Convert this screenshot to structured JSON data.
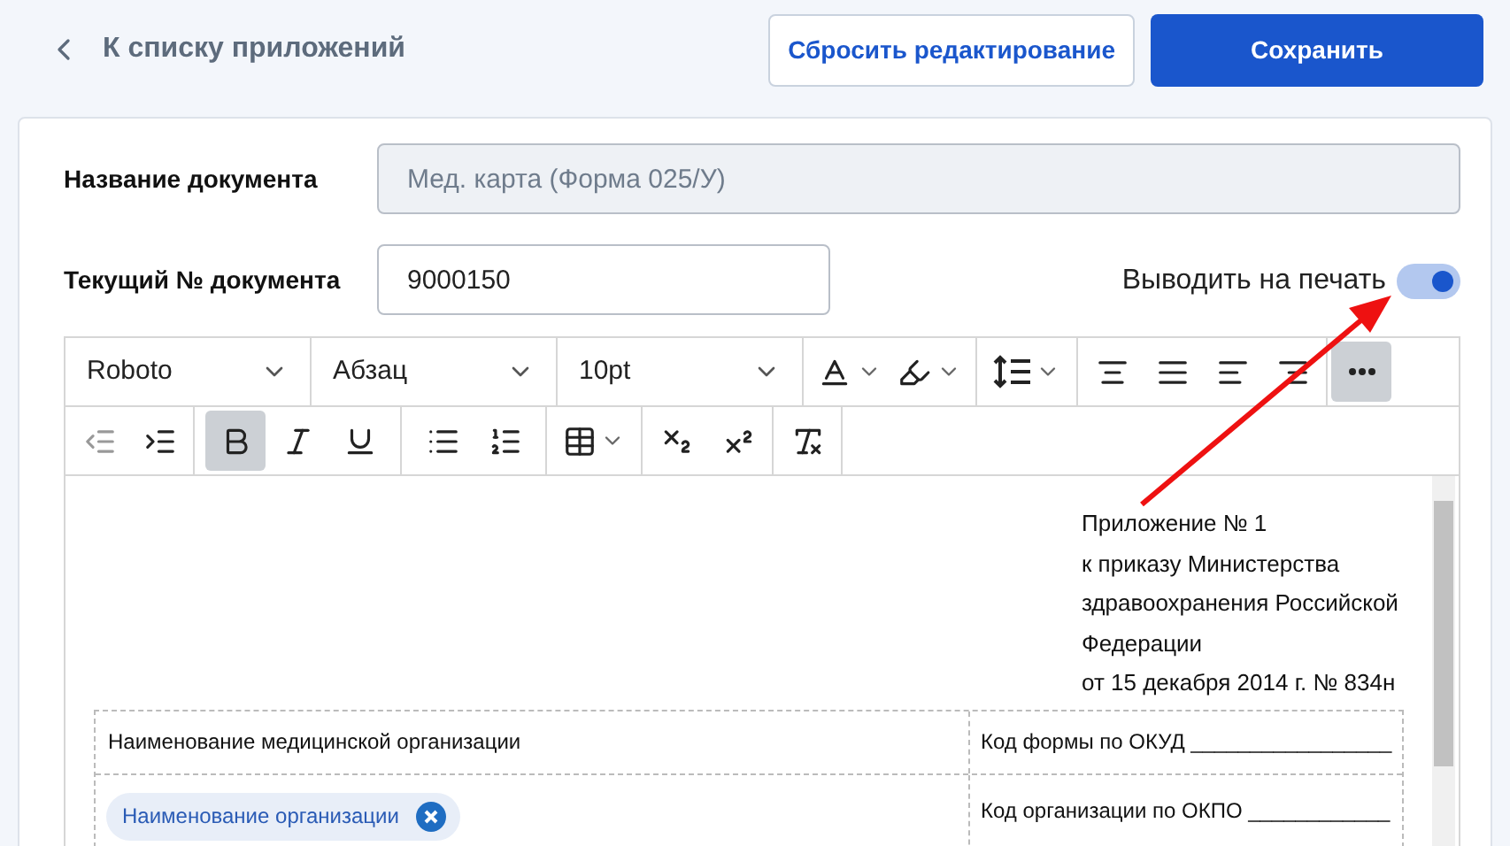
{
  "back_link": {
    "label": "К списку приложений"
  },
  "buttons": [
    {
      "kind": "secondary",
      "label": "Сбросить редактирование"
    },
    {
      "kind": "primary",
      "label": "Сохранить"
    }
  ],
  "form": {
    "document_name": {
      "label": "Название документа",
      "value": "Мед. карта (Форма 025/У)",
      "disabled": true
    },
    "document_number": {
      "label": "Текущий № документа",
      "value": "9000150",
      "disabled": false
    },
    "print_toggle": {
      "label": "Выводить на печать",
      "on": true
    }
  },
  "toolbar": {
    "font": "Roboto",
    "block": "Абзац",
    "size": "10pt",
    "more_active": true,
    "bold_active": true,
    "italic_active": false,
    "underline_active": false
  },
  "document": {
    "header_lines": [
      "Приложение № 1",
      "к приказу Министерства",
      "здравоохранения Российской",
      "Федерации",
      "от 15 декабря 2014 г. № 834н"
    ],
    "table": {
      "row_1": {
        "left": "Наименование медицинской организации",
        "right": "Код формы по ОКУД _________________"
      },
      "row_2": {
        "chip": "Наименование организации",
        "right_lines": [
          "Код организации по ОКПО ____________"
        ]
      }
    }
  }
}
